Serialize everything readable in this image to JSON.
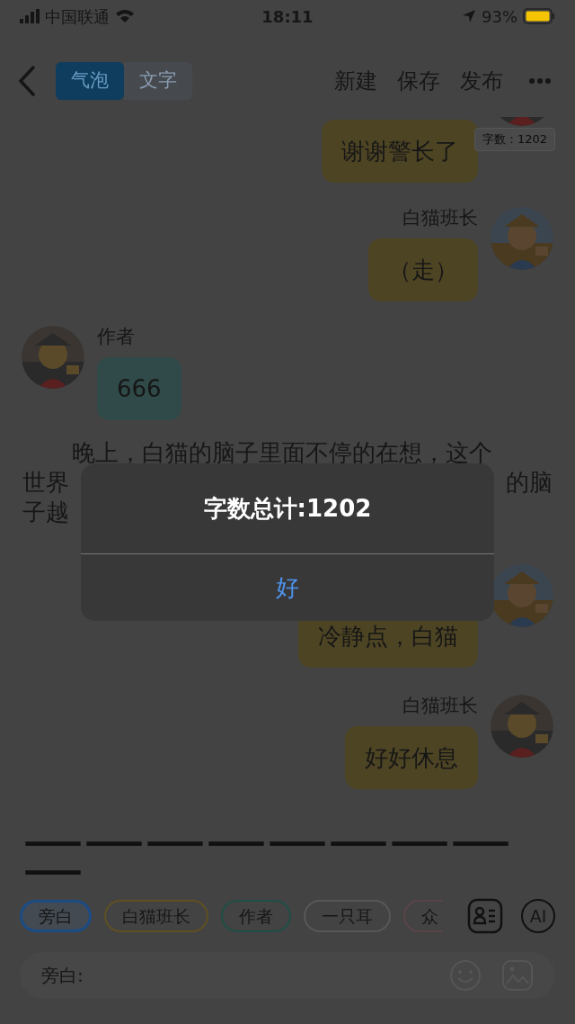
{
  "status_bar": {
    "carrier": "中国联通",
    "time": "18:11",
    "battery": "93%"
  },
  "nav": {
    "mode_tabs": [
      {
        "label": "气泡",
        "selected": true
      },
      {
        "label": "文字",
        "selected": false
      }
    ],
    "actions": [
      "新建",
      "保存",
      "发布"
    ]
  },
  "messages": [
    {
      "kind": "bubble_right",
      "text": "谢谢警长了",
      "color": "#4d4424",
      "badge": "字数：1202"
    },
    {
      "kind": "bubble_right",
      "speaker": "白猫班长",
      "text": "（走）",
      "color": "#4d4424"
    },
    {
      "kind": "bubble_left",
      "speaker": "作者",
      "text": "666",
      "color": "#2f4a48"
    },
    {
      "kind": "narration",
      "line_1": "晚上，白猫的脑子里面不停的在想，这个",
      "line_2_left": "世界",
      "line_2_right": "的脑",
      "line_3_left": "子越"
    },
    {
      "kind": "bubble_right",
      "text": "冷静点，白猫",
      "color": "#4d4424"
    },
    {
      "kind": "bubble_right",
      "speaker": "白猫班长",
      "text": "好好休息",
      "color": "#4d4424"
    },
    {
      "kind": "divider_text",
      "text": "—————————"
    }
  ],
  "roles": [
    {
      "label": "旁白",
      "selected": true,
      "color": "#1b4c85"
    },
    {
      "label": "白猫班长",
      "selected": false,
      "color": "#5e5020"
    },
    {
      "label": "作者",
      "selected": false,
      "color": "#1f4f46"
    },
    {
      "label": "一只耳",
      "selected": false,
      "color": "#575757"
    },
    {
      "label": "众",
      "selected": false,
      "color": "#5a4447"
    }
  ],
  "ai_button": "AI",
  "input": {
    "placeholder": "旁白:"
  },
  "dialog": {
    "title": "字数总计:1202",
    "button": "好"
  }
}
